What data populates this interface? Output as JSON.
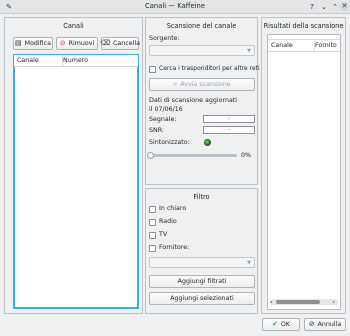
{
  "window": {
    "title": "Canali — Kaffeine"
  },
  "channels_panel": {
    "title": "Canali",
    "edit_label": "Modifica",
    "remove_label": "Rimuovi",
    "cancel_label": "Cancella",
    "columns": [
      "Canale",
      "Numero"
    ]
  },
  "scan_panel": {
    "title": "Scansione del canale",
    "source_label": "Sorgente:",
    "source_value": "",
    "search_transponders_label": "Cerca i trasponditori per altre reti",
    "start_scan_label": "Avvia scansione",
    "scan_data_label": "Dati di scansione aggiornati il 07/06/16",
    "signal_label": "Segnale:",
    "signal_value": "-",
    "snr_label": "SNR:",
    "snr_value": "-",
    "tuned_label": "Sintonizzato:",
    "progress_percent_label": "0%",
    "progress": 0
  },
  "filter_panel": {
    "title": "Filtro",
    "options": [
      {
        "label": "In chiaro",
        "checked": false
      },
      {
        "label": "Radio",
        "checked": false
      },
      {
        "label": "TV",
        "checked": false
      },
      {
        "label": "Fornitore:",
        "checked": false
      }
    ],
    "provider_value": "",
    "add_filtered_label": "Aggiungi filtrati",
    "add_selected_label": "Aggiungi selezionati"
  },
  "results_panel": {
    "title": "Risultati della scansione",
    "columns": [
      "Canale",
      "Fornito"
    ]
  },
  "footer": {
    "ok_label": "OK",
    "cancel_label": "Annulla"
  },
  "colors": {
    "accent": "#3daee9",
    "remove_icon": "#da4453",
    "ok_icon": "#27ae60",
    "led_on": "#2e9e2e"
  }
}
